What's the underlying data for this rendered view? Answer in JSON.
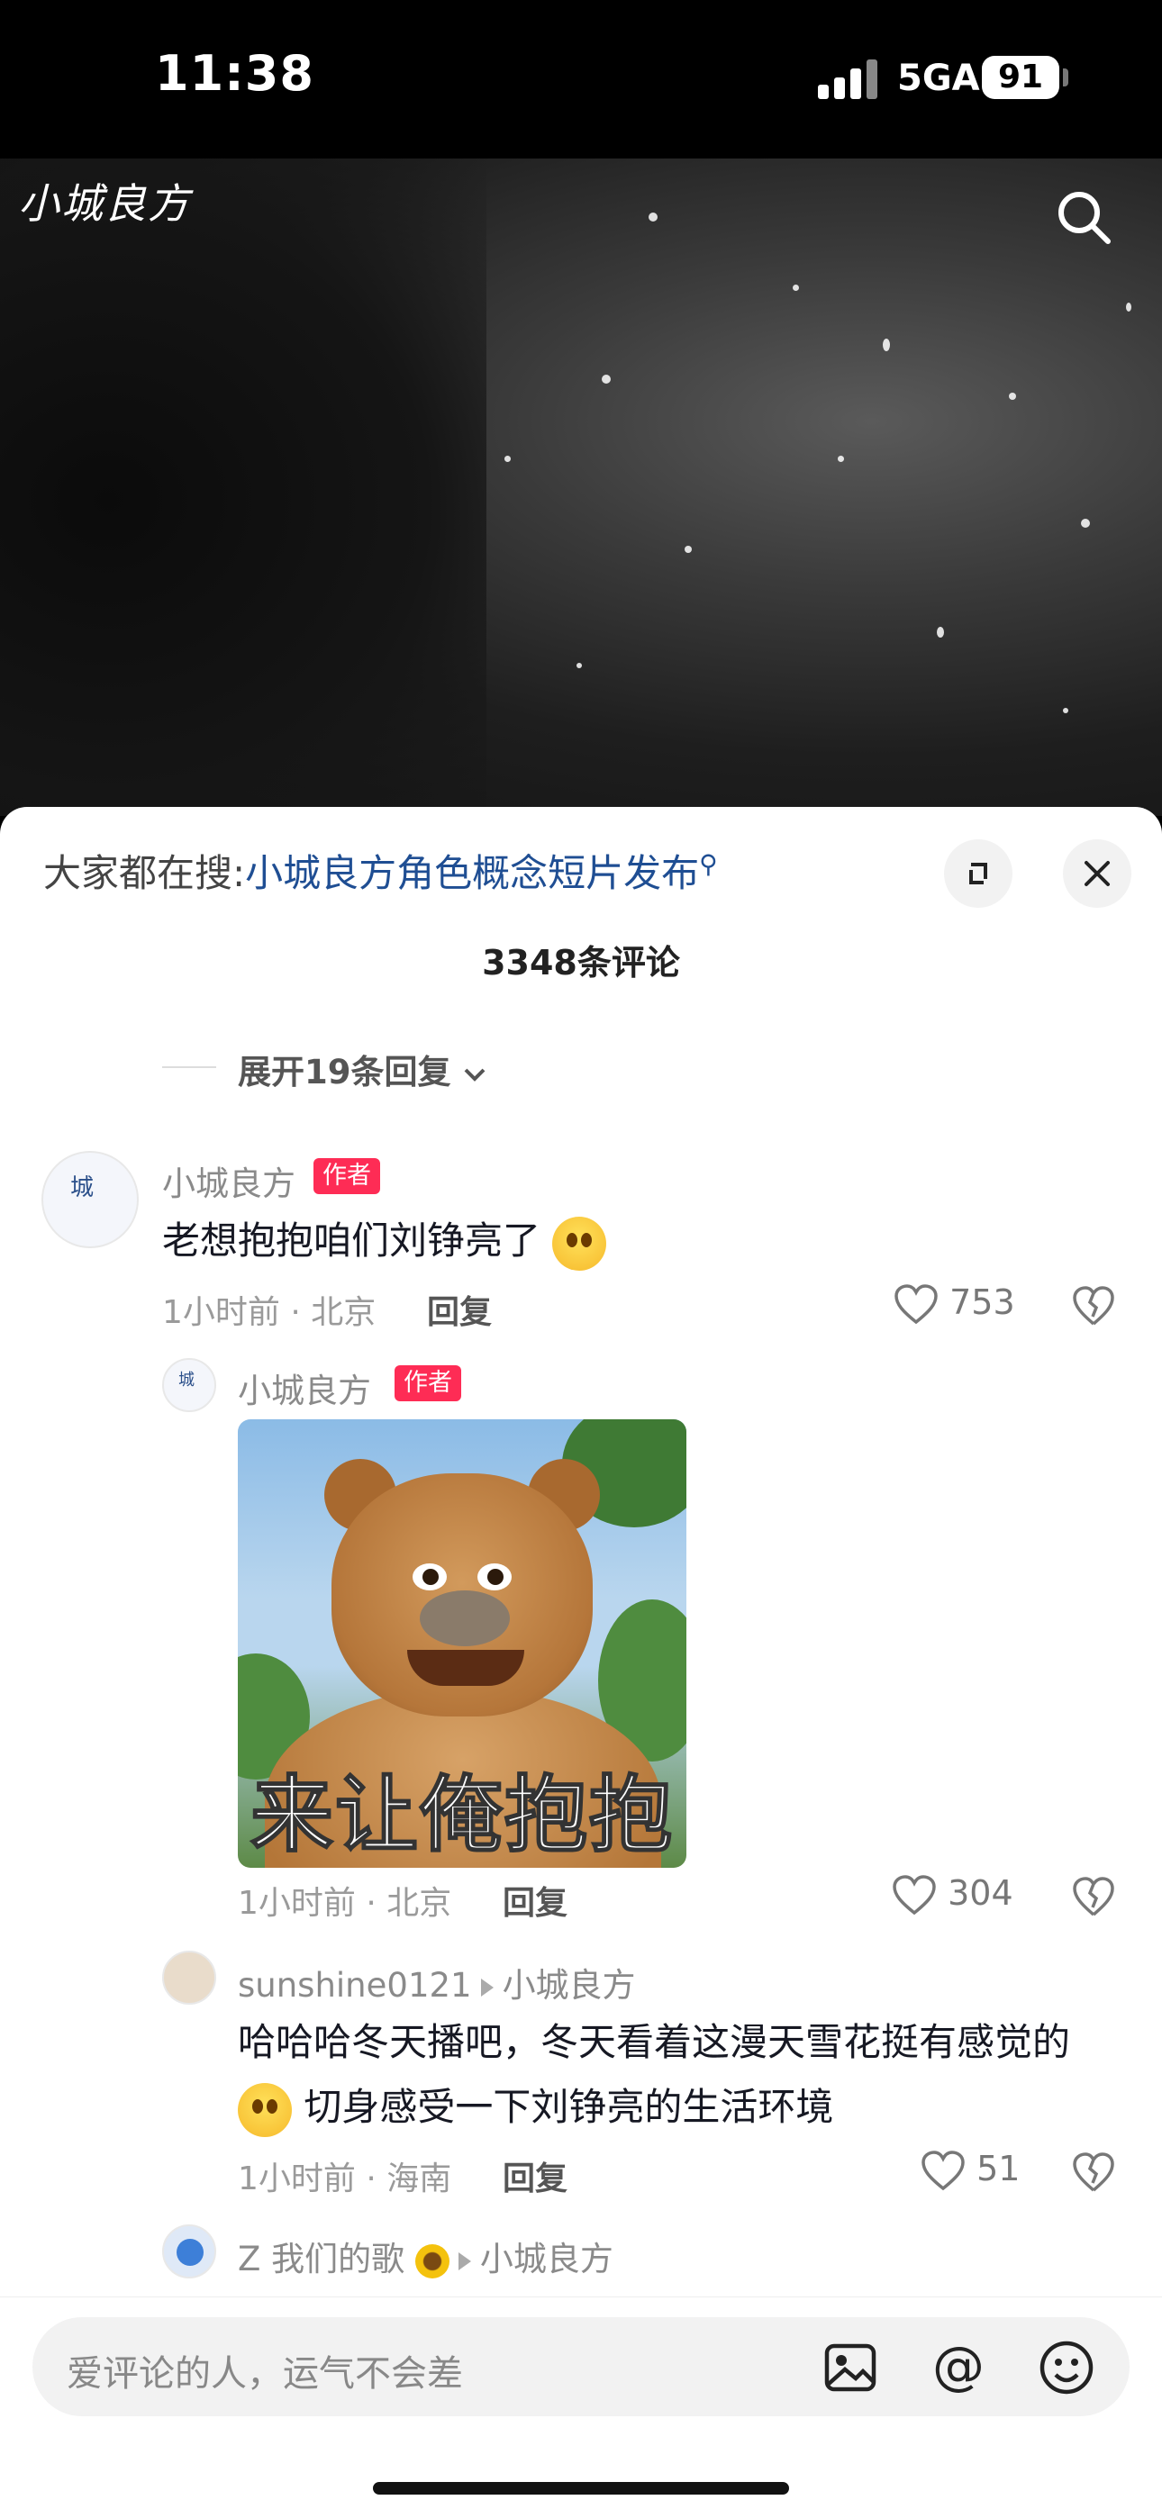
{
  "status": {
    "time": "11:38",
    "network": "5GA",
    "battery": "91"
  },
  "video": {
    "brand": "小城良方"
  },
  "sheet": {
    "trend_label": "大家都在搜:",
    "trend_link": "小城良方角色概念短片发布",
    "comment_count": "3348条评论",
    "expand_replies": "展开19条回复"
  },
  "comments": [
    {
      "name": "小城良方",
      "tag": "作者",
      "text": "老想抱抱咱们刘铮亮了",
      "time": "1小时前 · 北京",
      "reply": "回复",
      "likes": "753"
    },
    {
      "name": "小城良方",
      "tag": "作者",
      "sticker_caption": "来让俺抱抱",
      "time": "1小时前 · 北京",
      "reply": "回复",
      "likes": "304"
    },
    {
      "name": "sunshine0121",
      "reply_to": "小城良方",
      "text_line1": "哈哈哈冬天播吧，冬天看着这漫天雪花挺有感觉的",
      "text_line2": "切身感受一下刘铮亮的生活环境",
      "time": "1小时前 · 海南",
      "reply": "回复",
      "likes": "51"
    },
    {
      "name": "Z 我们的歌",
      "reply_to": "小城良方"
    }
  ],
  "input": {
    "placeholder": "爱评论的人，运气不会差"
  },
  "icons": [
    "search-icon",
    "expand-icon",
    "close-icon",
    "chevron-down-icon",
    "heart-icon",
    "broken-heart-icon",
    "image-icon",
    "at-icon",
    "emoji-icon"
  ],
  "colors": {
    "author_tag": "#fe2c55",
    "trend_link": "#1f4e93"
  }
}
